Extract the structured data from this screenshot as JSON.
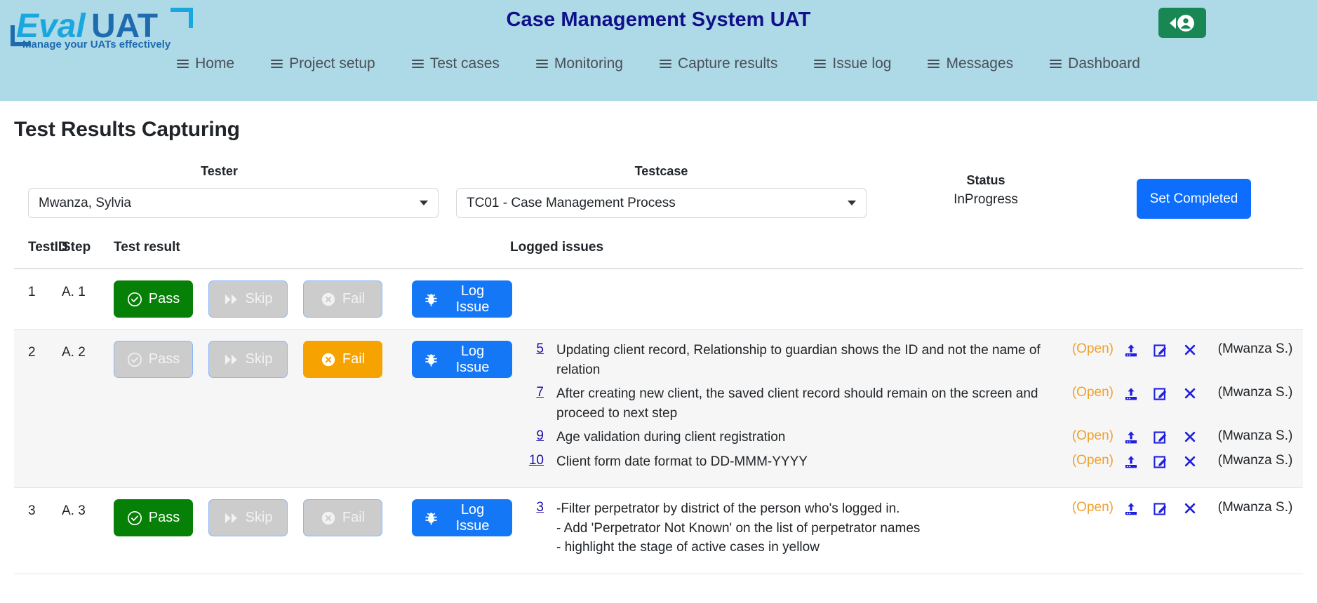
{
  "header": {
    "logo": {
      "text_primary": "Eval",
      "text_secondary": "UAT",
      "tagline": "Manage your UATs effectively",
      "color_primary": "#1aa7e0",
      "color_secondary": "#1e6bb0"
    },
    "title": "Case Management System UAT",
    "title_color": "#10108a",
    "background_color": "#aed9e6",
    "user_button": {
      "name": "user-account-button",
      "icon": "user-icon",
      "caret_icon": "caret-left-icon",
      "color": "#198754"
    },
    "nav": [
      {
        "label": "Home",
        "icon": "hamburger-icon"
      },
      {
        "label": "Project setup",
        "icon": "hamburger-icon"
      },
      {
        "label": "Test cases",
        "icon": "hamburger-icon"
      },
      {
        "label": "Monitoring",
        "icon": "hamburger-icon"
      },
      {
        "label": "Capture results",
        "icon": "hamburger-icon"
      },
      {
        "label": "Issue log",
        "icon": "hamburger-icon"
      },
      {
        "label": "Messages",
        "icon": "hamburger-icon"
      },
      {
        "label": "Dashboard",
        "icon": "hamburger-icon"
      }
    ]
  },
  "page": {
    "title": "Test Results Capturing"
  },
  "filters": {
    "tester_label": "Tester",
    "tester_value": "Mwanza, Sylvia",
    "testcase_label": "Testcase",
    "testcase_value": "TC01 - Case Management Process",
    "status_label": "Status",
    "status_value": "InProgress",
    "set_completed_label": "Set Completed",
    "set_completed_color": "#0d6efd"
  },
  "table": {
    "columns": {
      "testid": "TestID",
      "step": "Step",
      "result": "Test result",
      "issues": "Logged issues"
    },
    "result_buttons": {
      "pass": "Pass",
      "skip": "Skip",
      "fail": "Fail",
      "log_issue": "Log Issue"
    },
    "colors": {
      "pass_active": "#068006",
      "fail_active": "#f6a200",
      "inactive": "#cccccc",
      "log_issue": "#1477f5",
      "issue_link": "#1a0dab",
      "issue_status": "#f0a02a"
    },
    "rows": [
      {
        "testid": "1",
        "step": "A. 1",
        "result": "Pass",
        "issues": []
      },
      {
        "testid": "2",
        "step": "A. 2",
        "result": "Fail",
        "issues": [
          {
            "id": "5",
            "description": "Updating client record, Relationship to guardian shows the ID and not the name of relation",
            "status": "(Open)",
            "owner": "(Mwanza S.)"
          },
          {
            "id": "7",
            "description": "After creating new client, the saved client record should remain on the screen and proceed to next step",
            "status": "(Open)",
            "owner": "(Mwanza S.)"
          },
          {
            "id": "9",
            "description": "Age validation during client registration",
            "status": "(Open)",
            "owner": "(Mwanza S.)"
          },
          {
            "id": "10",
            "description": "Client form date format to DD-MMM-YYYY",
            "status": "(Open)",
            "owner": "(Mwanza S.)"
          }
        ]
      },
      {
        "testid": "3",
        "step": "A. 3",
        "result": "Pass",
        "issues": [
          {
            "id": "3",
            "description": "-Filter perpetrator by district of the person who's logged in.\n- Add 'Perpetrator Not Known' on the list of perpetrator names\n- highlight the stage of active cases in yellow",
            "status": "(Open)",
            "owner": "(Mwanza S.)"
          }
        ]
      }
    ],
    "action_icons": {
      "upload": "upload-icon",
      "edit": "edit-icon",
      "delete": "close-x-icon"
    }
  }
}
